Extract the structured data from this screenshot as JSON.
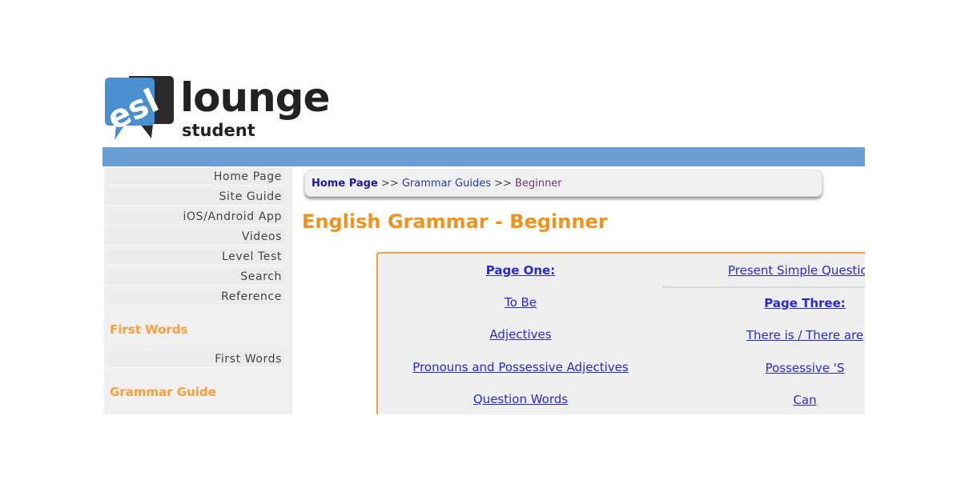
{
  "logo": {
    "word": "lounge",
    "sub": "student",
    "icon_text": "esl"
  },
  "colors": {
    "accent": "#f0921e",
    "bar": "#6b9fd4",
    "link": "#2a2ad0"
  },
  "sidebar": {
    "items": [
      "Home Page",
      "Site Guide",
      "iOS/Android App",
      "Videos",
      "Level Test",
      "Search",
      "Reference"
    ],
    "sections": [
      {
        "heading": "First Words",
        "items": [
          "First Words"
        ]
      },
      {
        "heading": "Grammar Guide",
        "items": []
      }
    ]
  },
  "breadcrumb": {
    "home": "Home Page",
    "sep": ">>",
    "middle": "Grammar Guides",
    "current": "Beginner"
  },
  "page_title": "English Grammar - Beginner",
  "grammar_table": {
    "col1": [
      {
        "label": "Page One:",
        "heading": true
      },
      {
        "label": "To Be"
      },
      {
        "label": "Adjectives"
      },
      {
        "label": "Pronouns and Possessive Adjectives"
      },
      {
        "label": "Question Words"
      }
    ],
    "col2": [
      {
        "label": "Present Simple Questio"
      },
      {
        "label": "Page Three:",
        "heading": true
      },
      {
        "label": "There is / There are"
      },
      {
        "label": "Possessive 'S"
      },
      {
        "label": "Can"
      }
    ]
  }
}
